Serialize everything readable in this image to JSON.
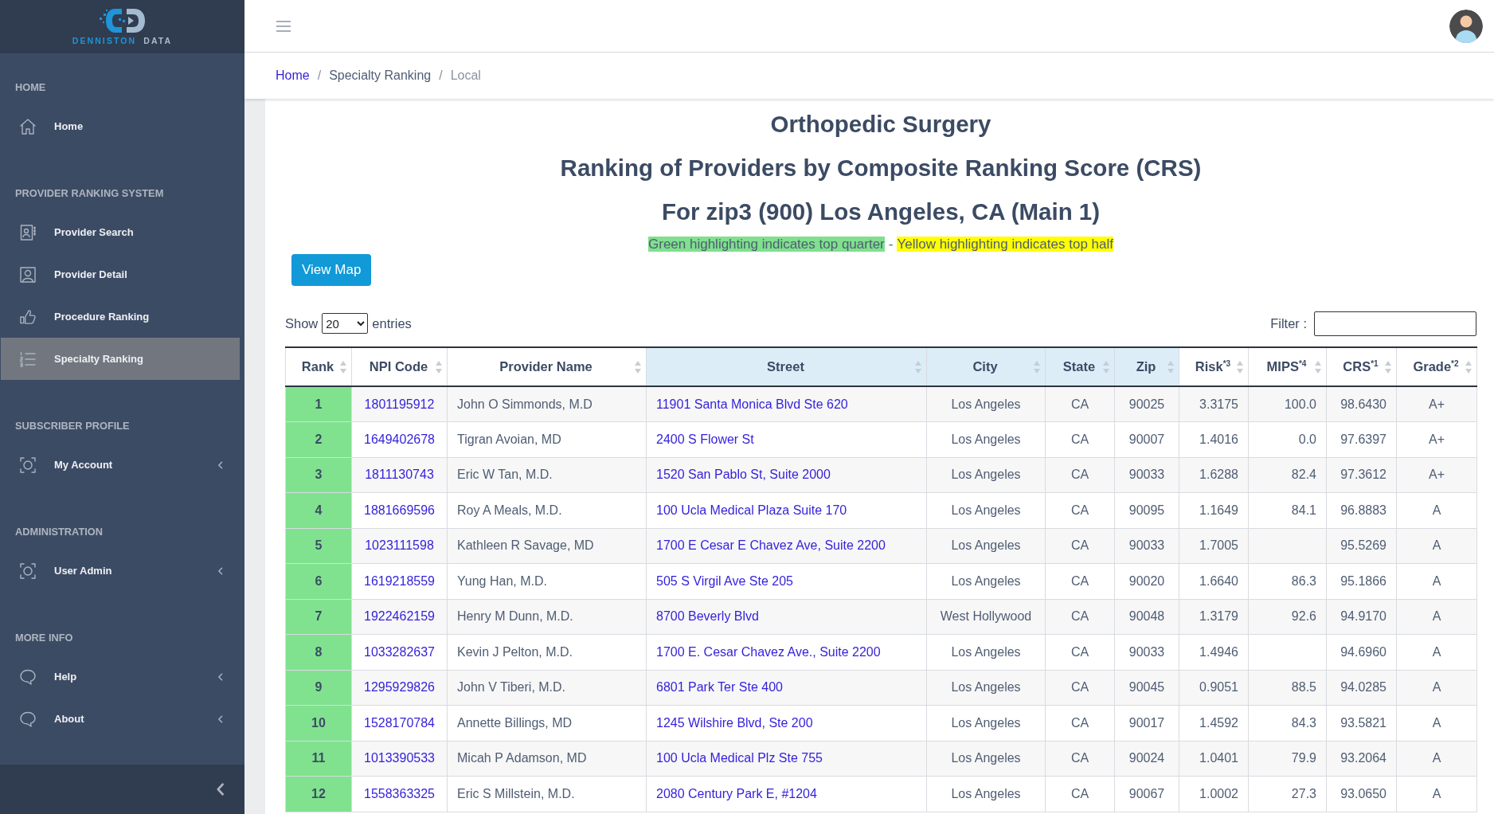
{
  "logo": {
    "words": [
      "DENNISTON",
      "DATA"
    ]
  },
  "sidebar": {
    "sections": [
      {
        "title": "HOME",
        "items": [
          {
            "label": "Home",
            "kind": "link",
            "selected": false
          }
        ]
      },
      {
        "title": "PROVIDER RANKING SYSTEM",
        "items": [
          {
            "label": "Provider Search",
            "kind": "link",
            "selected": false
          },
          {
            "label": "Provider Detail",
            "kind": "link",
            "selected": false
          },
          {
            "label": "Procedure Ranking",
            "kind": "link",
            "selected": false
          },
          {
            "label": "Specialty Ranking",
            "kind": "link",
            "selected": true
          }
        ]
      },
      {
        "title": "SUBSCRIBER PROFILE",
        "items": [
          {
            "label": "My Account",
            "kind": "group",
            "expanded": false,
            "selected": false
          }
        ]
      },
      {
        "title": "ADMINISTRATION",
        "items": [
          {
            "label": "User Admin",
            "kind": "group",
            "expanded": false,
            "selected": false
          }
        ]
      },
      {
        "title": "MORE INFO",
        "items": [
          {
            "label": "Help",
            "kind": "group",
            "expanded": false,
            "selected": false
          },
          {
            "label": "About",
            "kind": "group",
            "expanded": false,
            "selected": false
          }
        ]
      }
    ]
  },
  "breadcrumb": {
    "separator": "/",
    "items": [
      {
        "label": "Home",
        "kind": "link"
      },
      {
        "label": "Specialty Ranking",
        "kind": "text"
      },
      {
        "label": "Local",
        "kind": "current"
      }
    ]
  },
  "page": {
    "titles": [
      "Orthopedic Surgery",
      "Ranking of Providers by Composite Ranking Score (CRS)",
      "For zip3 (900) Los Angeles, CA (Main 1)"
    ],
    "legend": {
      "separator": "-",
      "items": [
        {
          "text": "Green highlighting indicates top quarter",
          "color": "#7fe08d"
        },
        {
          "text": "Yellow highlighting indicates top half",
          "color": "#ffff00"
        }
      ]
    },
    "view_map_button": "View Map",
    "length_menu": {
      "label_before": "Show",
      "value": "20",
      "label_after": "entries"
    },
    "filter": {
      "label": "Filter :"
    }
  },
  "table": {
    "columns": [
      {
        "label": "Rank",
        "sortable": true,
        "highlighted": false
      },
      {
        "label": "NPI Code",
        "sortable": true,
        "highlighted": false
      },
      {
        "label": "Provider Name",
        "sortable": true,
        "highlighted": false
      },
      {
        "label": "Street",
        "sortable": true,
        "highlighted": true
      },
      {
        "label": "City",
        "sortable": true,
        "highlighted": true
      },
      {
        "label": "State",
        "sortable": true,
        "highlighted": true
      },
      {
        "label": "Zip",
        "sortable": true,
        "highlighted": true
      },
      {
        "label": "Risk$^{*3}$",
        "sortable": true,
        "highlighted": false
      },
      {
        "label": "MIPS$^{*4}$",
        "sortable": true,
        "highlighted": false
      },
      {
        "label": "CRS$^{*1}$",
        "sortable": true,
        "highlighted": false
      },
      {
        "label": "Grade$^{*2}$",
        "sortable": true,
        "highlighted": false
      }
    ],
    "rows": [
      {
        "rank": "1",
        "top_quarter": true,
        "npi_code": "1801195912",
        "provider_name": "John O Simmonds, M.D",
        "street": "11901 Santa Monica Blvd Ste 620",
        "city": "Los Angeles",
        "state": "CA",
        "zip": "90025",
        "risk": "3.3175",
        "mips": "100.0",
        "crs": "98.6430",
        "grade": "A+"
      },
      {
        "rank": "2",
        "top_quarter": true,
        "npi_code": "1649402678",
        "provider_name": "Tigran Avoian, MD",
        "street": "2400 S Flower St",
        "city": "Los Angeles",
        "state": "CA",
        "zip": "90007",
        "risk": "1.4016",
        "mips": "0.0",
        "crs": "97.6397",
        "grade": "A+"
      },
      {
        "rank": "3",
        "top_quarter": true,
        "npi_code": "1811130743",
        "provider_name": "Eric W Tan, M.D.",
        "street": "1520 San Pablo St, Suite 2000",
        "city": "Los Angeles",
        "state": "CA",
        "zip": "90033",
        "risk": "1.6288",
        "mips": "82.4",
        "crs": "97.3612",
        "grade": "A+"
      },
      {
        "rank": "4",
        "top_quarter": true,
        "npi_code": "1881669596",
        "provider_name": "Roy A Meals, M.D.",
        "street": "100 Ucla Medical Plaza Suite 170",
        "city": "Los Angeles",
        "state": "CA",
        "zip": "90095",
        "risk": "1.1649",
        "mips": "84.1",
        "crs": "96.8883",
        "grade": "A"
      },
      {
        "rank": "5",
        "top_quarter": true,
        "npi_code": "1023111598",
        "provider_name": "Kathleen R Savage, MD",
        "street": "1700 E Cesar E Chavez Ave, Suite 2200",
        "city": "Los Angeles",
        "state": "CA",
        "zip": "90033",
        "risk": "1.7005",
        "crs": "95.5269",
        "grade": "A"
      },
      {
        "rank": "6",
        "top_quarter": true,
        "npi_code": "1619218559",
        "provider_name": "Yung Han, M.D.",
        "street": "505 S Virgil Ave Ste 205",
        "city": "Los Angeles",
        "state": "CA",
        "zip": "90020",
        "risk": "1.6640",
        "mips": "86.3",
        "crs": "95.1866",
        "grade": "A"
      },
      {
        "rank": "7",
        "top_quarter": true,
        "npi_code": "1922462159",
        "provider_name": "Henry M Dunn, M.D.",
        "street": "8700 Beverly Blvd",
        "city": "West Hollywood",
        "state": "CA",
        "zip": "90048",
        "risk": "1.3179",
        "mips": "92.6",
        "crs": "94.9170",
        "grade": "A"
      },
      {
        "rank": "8",
        "top_quarter": true,
        "npi_code": "1033282637",
        "provider_name": "Kevin J Pelton, M.D.",
        "street": "1700 E. Cesar Chavez Ave., Suite 2200",
        "city": "Los Angeles",
        "state": "CA",
        "zip": "90033",
        "risk": "1.4946",
        "crs": "94.6960",
        "grade": "A"
      },
      {
        "rank": "9",
        "top_quarter": true,
        "npi_code": "1295929826",
        "provider_name": "John V Tiberi, M.D.",
        "street": "6801 Park Ter Ste 400",
        "city": "Los Angeles",
        "state": "CA",
        "zip": "90045",
        "risk": "0.9051",
        "mips": "88.5",
        "crs": "94.0285",
        "grade": "A"
      },
      {
        "rank": "10",
        "top_quarter": true,
        "npi_code": "1528170784",
        "provider_name": "Annette Billings, MD",
        "street": "1245 Wilshire Blvd, Ste 200",
        "city": "Los Angeles",
        "state": "CA",
        "zip": "90017",
        "risk": "1.4592",
        "mips": "84.3",
        "crs": "93.5821",
        "grade": "A"
      },
      {
        "rank": "11",
        "top_quarter": true,
        "npi_code": "1013390533",
        "provider_name": "Micah P Adamson, MD",
        "street": "100 Ucla Medical Plz Ste 755",
        "city": "Los Angeles",
        "state": "CA",
        "zip": "90024",
        "risk": "1.0401",
        "mips": "79.9",
        "crs": "93.2064",
        "grade": "A"
      },
      {
        "rank": "12",
        "top_quarter": true,
        "npi_code": "1558363325",
        "provider_name": "Eric S Millstein, M.D.",
        "street": "2080 Century Park E, #1204",
        "city": "Los Angeles",
        "state": "CA",
        "zip": "90067",
        "risk": "1.0002",
        "mips": "27.3",
        "crs": "93.0650",
        "grade": "A"
      }
    ]
  }
}
